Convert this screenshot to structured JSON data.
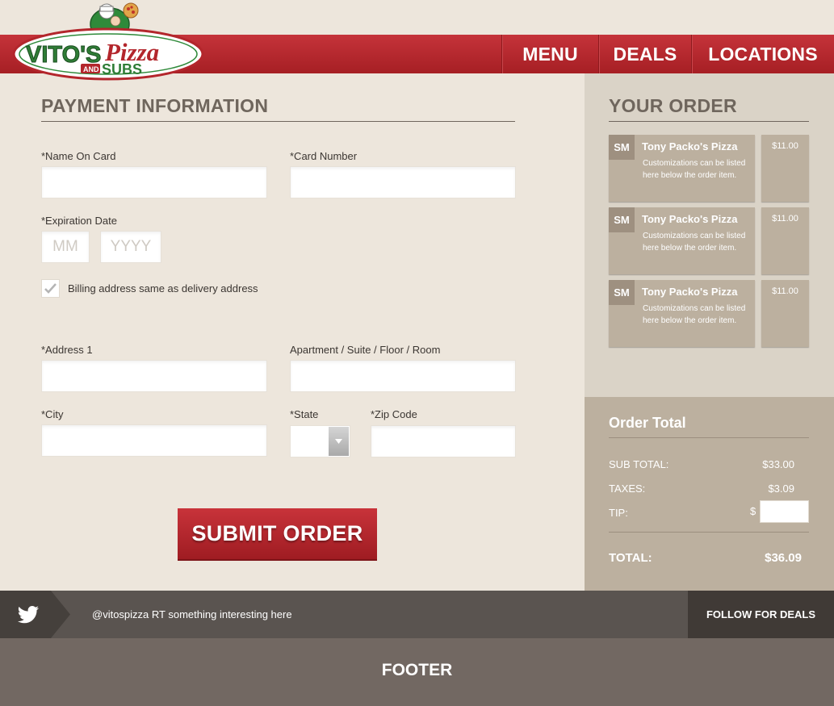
{
  "brand": {
    "logo_main": "VITO'S",
    "logo_pizza": "Pizza",
    "logo_and": "AND",
    "logo_subs": "SUBS",
    "primary_red": "#b3262c",
    "cream_bg": "#ede6dc",
    "tan": "#bcb09f"
  },
  "nav": {
    "menu": "MENU",
    "deals": "DEALS",
    "locations": "LOCATIONS"
  },
  "payment": {
    "title": "PAYMENT INFORMATION",
    "name_on_card_label": "*Name On Card",
    "name_on_card_value": "",
    "card_number_label": "*Card Number",
    "card_number_value": "",
    "expiration_label": "*Expiration Date",
    "exp_month_placeholder": "MM",
    "exp_year_placeholder": "YYYY",
    "billing_same_label": "Billing address same as delivery address",
    "billing_same_checked": true,
    "address1_label": "*Address 1",
    "address2_label": "Apartment / Suite / Floor / Room",
    "city_label": "*City",
    "state_label": "*State",
    "state_value": "",
    "zip_label": "*Zip Code",
    "submit_label": "SUBMIT ORDER"
  },
  "order": {
    "title": "YOUR ORDER",
    "items": [
      {
        "size": "SM",
        "name": "Tony Packo's Pizza",
        "note": "Customizations can be listed here below the order item.",
        "price": "$11.00"
      },
      {
        "size": "SM",
        "name": "Tony Packo's Pizza",
        "note": "Customizations can be listed here below the order item.",
        "price": "$11.00"
      },
      {
        "size": "SM",
        "name": "Tony Packo's Pizza",
        "note": "Customizations can be listed here below the order item.",
        "price": "$11.00"
      }
    ]
  },
  "totals": {
    "title": "Order Total",
    "subtotal_label": "SUB TOTAL:",
    "subtotal_value": "$33.00",
    "taxes_label": "TAXES:",
    "taxes_value": "$3.09",
    "tip_label": "TIP:",
    "tip_currency": "$",
    "tip_value": "",
    "total_label": "TOTAL:",
    "total_value": "$36.09"
  },
  "twitter": {
    "icon": "twitter-bird-icon",
    "tweet": "@vitospizza RT something interesting here",
    "follow_label": "FOLLOW FOR DEALS"
  },
  "footer": {
    "text": "FOOTER"
  }
}
